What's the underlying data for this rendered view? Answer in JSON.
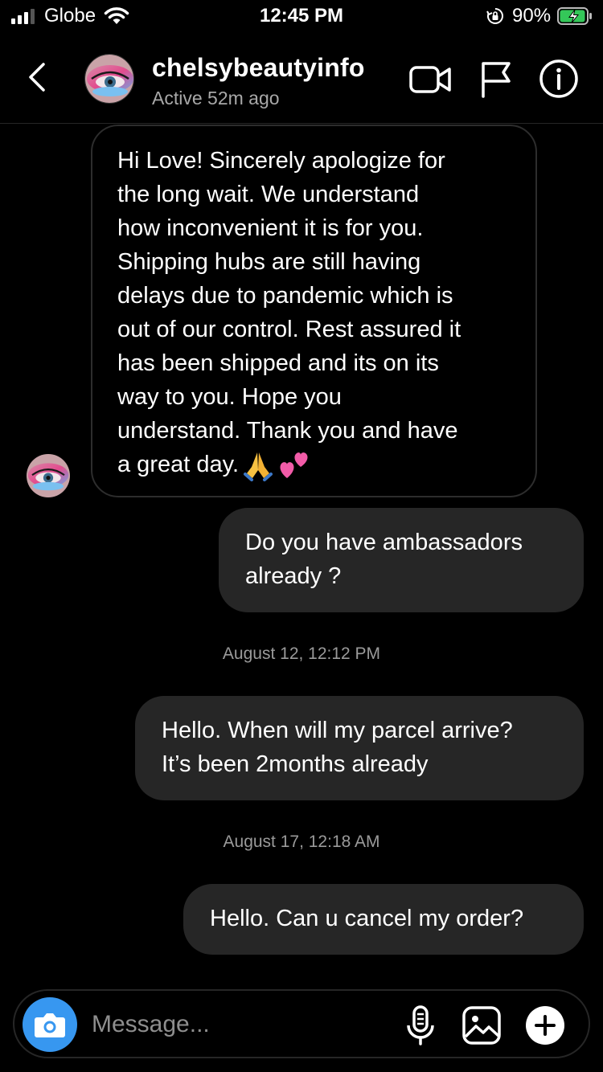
{
  "status_bar": {
    "carrier": "Globe",
    "time": "12:45 PM",
    "battery_percent": "90%",
    "icons": [
      "signal-icon",
      "wifi-icon",
      "rotation-lock-icon",
      "battery-charging-icon"
    ]
  },
  "header": {
    "username": "chelsybeautyinfo",
    "active_status": "Active 52m ago",
    "icons": [
      "back-chevron-icon",
      "video-call-icon",
      "flag-icon",
      "info-icon"
    ]
  },
  "messages": [
    {
      "direction": "incoming",
      "text": "Hi Love! Sincerely apologize for\nthe long wait. We understand\nhow inconvenient it  is for you.\nShipping hubs are still having\ndelays due to pandemic which is\nout of our control. Rest assured it\nhas been shipped and its on its\nway to you. Hope you\nunderstand. Thank you and have\na great day.",
      "emojis": [
        "folded-hands-emoji",
        "two-hearts-emoji"
      ]
    },
    {
      "direction": "outgoing",
      "text": "Do you have ambassadors\nalready ?"
    },
    {
      "type": "timestamp",
      "text": "August 12, 12:12 PM"
    },
    {
      "direction": "outgoing",
      "text": "Hello. When will my parcel arrive?\nIt’s been 2months already"
    },
    {
      "type": "timestamp",
      "text": "August 17, 12:18 AM"
    },
    {
      "direction": "outgoing",
      "text": "Hello. Can u cancel my order?"
    }
  ],
  "composer": {
    "placeholder": "Message...",
    "value": "",
    "icons": [
      "camera-icon",
      "microphone-icon",
      "gallery-icon",
      "plus-icon"
    ]
  },
  "colors": {
    "background": "#000000",
    "outgoing_bubble": "#262626",
    "incoming_border": "#2d2d2d",
    "secondary_text": "#a8a8a8",
    "camera_accent": "#3797f0",
    "battery_green": "#34c759"
  }
}
